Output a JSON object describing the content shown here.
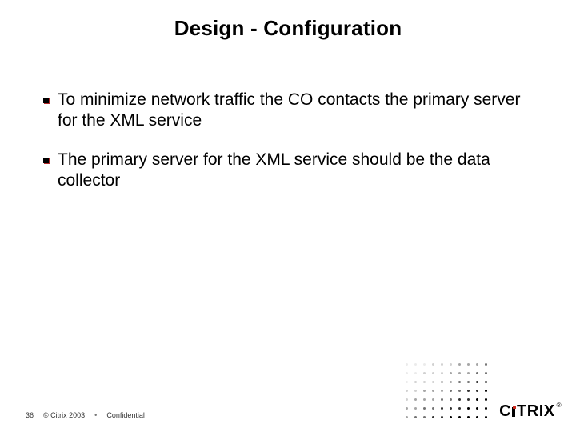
{
  "title": "Design - Configuration",
  "bullets": [
    "To minimize network traffic the CO contacts the primary server for the XML service",
    "The primary server for the XML service should be the data collector"
  ],
  "footer": {
    "page": "36",
    "copyright": "© Citrix 2003",
    "confidential": "Confidential"
  },
  "brand": {
    "pre": "C",
    "post": "TRIX",
    "reg": "®"
  }
}
